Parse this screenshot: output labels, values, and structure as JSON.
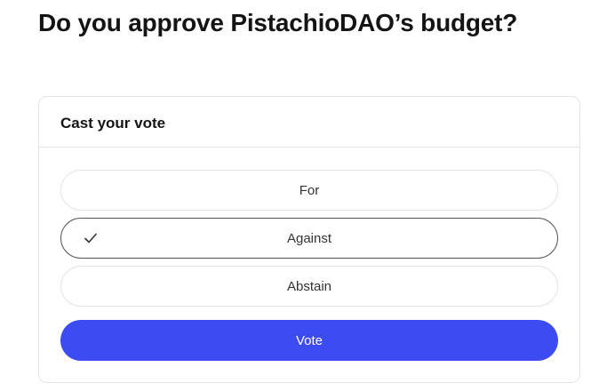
{
  "page": {
    "title": "Do you approve PistachioDAO’s budget?"
  },
  "vote_card": {
    "title": "Cast your vote",
    "options": [
      {
        "label": "For",
        "selected": false
      },
      {
        "label": "Against",
        "selected": true
      },
      {
        "label": "Abstain",
        "selected": false
      }
    ],
    "submit_label": "Vote"
  },
  "colors": {
    "accent": "#3d4cf2",
    "border": "#e4e4e7",
    "selected_border": "#555555"
  },
  "icons": {
    "selected_option": "check-icon"
  }
}
